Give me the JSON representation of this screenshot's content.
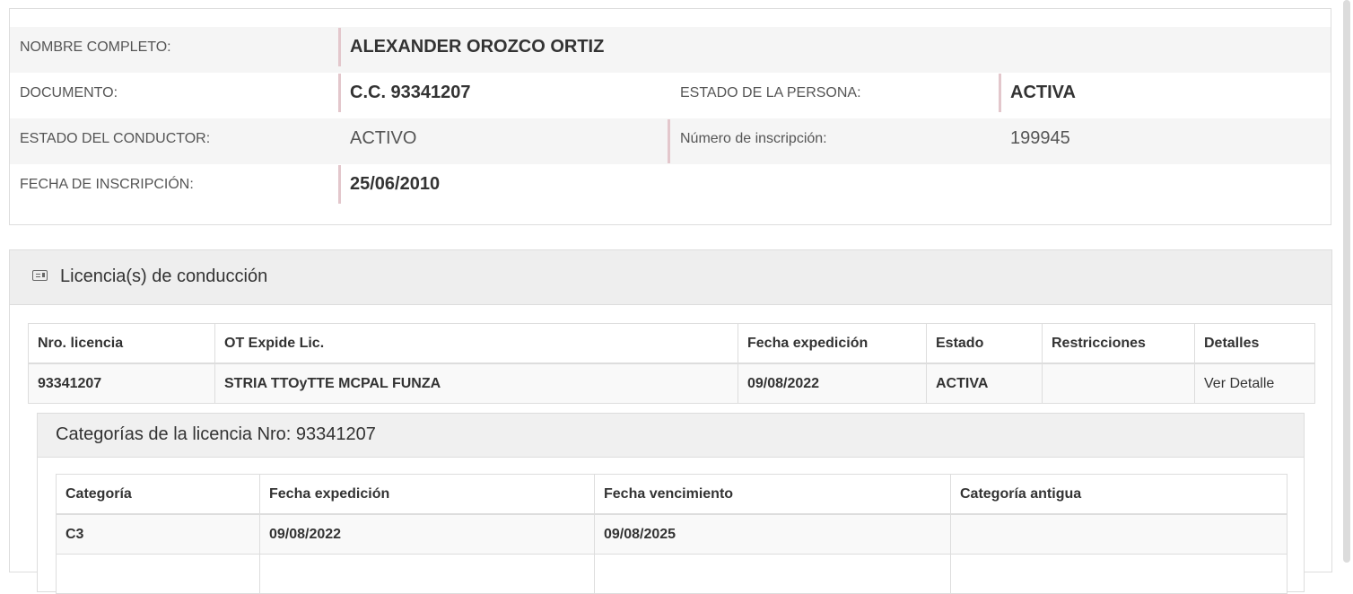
{
  "person": {
    "nombre_label": "NOMBRE COMPLETO:",
    "nombre_value": "ALEXANDER OROZCO ORTIZ",
    "documento_label": "DOCUMENTO:",
    "documento_value": "C.C. 93341207",
    "estado_persona_label": "ESTADO DE LA PERSONA:",
    "estado_persona_value": "ACTIVA",
    "estado_conductor_label": "ESTADO DEL CONDUCTOR:",
    "estado_conductor_value": "ACTIVO",
    "numero_inscripcion_label": "Número de inscripción:",
    "numero_inscripcion_value": "199945",
    "fecha_inscripcion_label": "FECHA DE INSCRIPCIÓN:",
    "fecha_inscripcion_value": "25/06/2010"
  },
  "licencias": {
    "icon": "id-card-icon",
    "title": "Licencia(s) de conducción",
    "columns": [
      "Nro. licencia",
      "OT Expide Lic.",
      "Fecha expedición",
      "Estado",
      "Restricciones",
      "Detalles"
    ],
    "rows": [
      {
        "nro": "93341207",
        "ot": "STRIA TTOyTTE MCPAL FUNZA",
        "fecha": "09/08/2022",
        "estado": "ACTIVA",
        "restricciones": "",
        "detalles": "Ver Detalle"
      }
    ]
  },
  "categorias": {
    "title": "Categorías de la licencia Nro: 93341207",
    "columns": [
      "Categoría",
      "Fecha expedición",
      "Fecha vencimiento",
      "Categoría antigua"
    ],
    "rows": [
      {
        "categoria": "C3",
        "expedicion": "09/08/2022",
        "vencimiento": "09/08/2025",
        "antigua": ""
      }
    ]
  }
}
